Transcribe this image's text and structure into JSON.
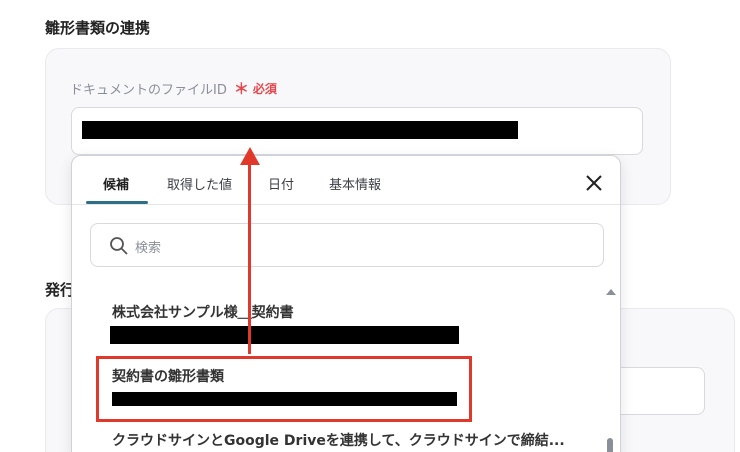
{
  "section1": {
    "title": "雛形書類の連携",
    "field_label": "ドキュメントのファイルID",
    "required_mark": "＊",
    "required_text": "必須"
  },
  "section2": {
    "title_partial": "発行"
  },
  "dropdown": {
    "tabs": [
      {
        "label": "候補",
        "active": true
      },
      {
        "label": "取得した値",
        "active": false
      },
      {
        "label": "日付",
        "active": false
      },
      {
        "label": "基本情報",
        "active": false
      }
    ],
    "search_placeholder": "検索",
    "items": [
      {
        "title": "株式会社サンプル様＿契約書"
      },
      {
        "title": "契約書の雛形書類"
      },
      {
        "title": "クラウドサインとGoogle Driveを連携して、クラウドサインで締結..."
      }
    ]
  },
  "colors": {
    "accent_tab": "#2f6f85",
    "annotation_red": "#e0392b",
    "required_red": "#e5484d"
  }
}
